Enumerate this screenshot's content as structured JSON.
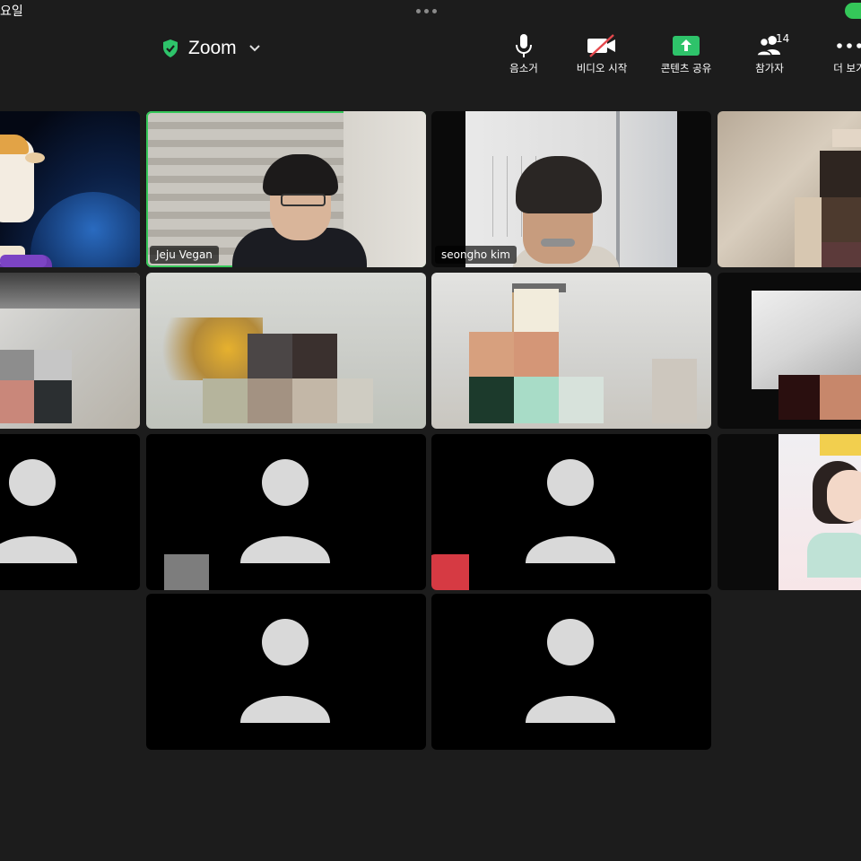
{
  "status_bar": {
    "time_fragment": "요일"
  },
  "meeting": {
    "title": "Zoom"
  },
  "toolbar": {
    "mute_label": "음소거",
    "video_label": "비디오 시작",
    "share_label": "콘텐츠 공유",
    "participants_label": "참가자",
    "participants_count": "14",
    "more_label": "더 보기"
  },
  "participants": [
    {
      "name": "Jeju Vegan"
    },
    {
      "name": "seongho kim"
    }
  ],
  "colors": {
    "background": "#1c1c1c",
    "active_speaker_border": "#35c759",
    "share_green": "#2ec36a",
    "video_off_red": "#e5484d"
  }
}
